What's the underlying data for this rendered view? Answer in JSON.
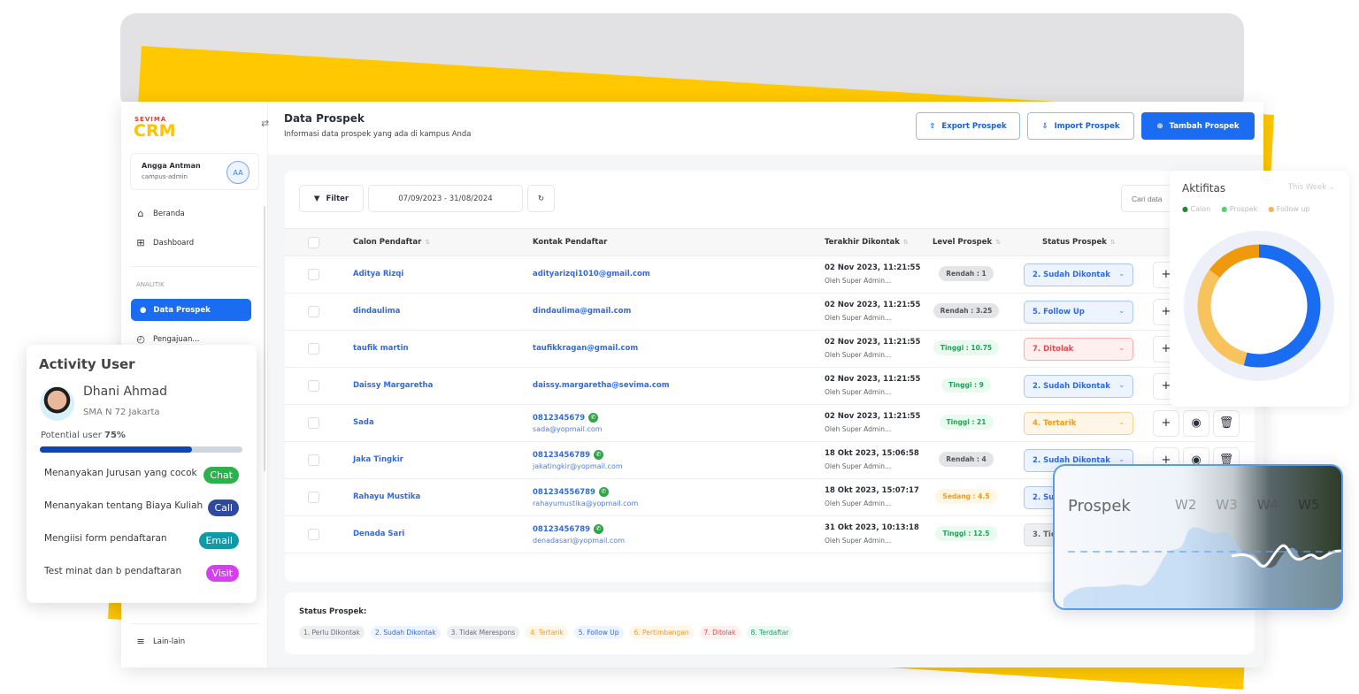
{
  "app": {
    "logo_top": "SEVIMA",
    "logo": "CRM"
  },
  "user": {
    "name": "Angga Antman",
    "role": "campus-admin",
    "initials": "AA"
  },
  "sidebar": {
    "items": [
      {
        "label": "Beranda",
        "icon": "home-icon"
      },
      {
        "label": "Dashboard",
        "icon": "grid-icon"
      }
    ],
    "section": "ANALITIK",
    "active": "Data Prospek",
    "next": "Pengajuan...",
    "bottom": "Lain-lain"
  },
  "header": {
    "title": "Data Prospek",
    "subtitle": "Informasi data prospek yang ada di kampus Anda",
    "export": "Export Prospek",
    "import": "Import Prospek",
    "add": "Tambah Prospek"
  },
  "toolbar": {
    "filter": "Filter",
    "date_range": "07/09/2023 - 31/08/2024",
    "search_placeholder": "Cari data"
  },
  "table": {
    "columns": [
      "Calon Pendaftar",
      "Kontak Pendaftar",
      "Terakhir Dikontak",
      "Level Prospek",
      "Status Prospek"
    ],
    "rows": [
      {
        "name": "Aditya Rizqi",
        "phone": "",
        "email": "adityarizqi1010@gmail.com",
        "date": "02 Nov 2023, 11:21:55",
        "by": "Oleh Super Admin...",
        "level": "Rendah : 1",
        "level_type": "low",
        "status": "2. Sudah Dikontak",
        "status_type": "blue"
      },
      {
        "name": "dindaulima",
        "phone": "",
        "email": "dindaulima@gmail.com",
        "date": "02 Nov 2023, 11:21:55",
        "by": "Oleh Super Admin...",
        "level": "Rendah : 3.25",
        "level_type": "low",
        "status": "5. Follow Up",
        "status_type": "blue"
      },
      {
        "name": "taufik martin",
        "phone": "",
        "email": "taufikkragan@gmail.com",
        "date": "02 Nov 2023, 11:21:55",
        "by": "Oleh Super Admin...",
        "level": "Tinggi : 10.75",
        "level_type": "high",
        "status": "7. Ditolak",
        "status_type": "red"
      },
      {
        "name": "Daissy Margaretha",
        "phone": "",
        "email": "daissy.margaretha@sevima.com",
        "date": "02 Nov 2023, 11:21:55",
        "by": "Oleh Super Admin...",
        "level": "Tinggi : 9",
        "level_type": "high",
        "status": "2. Sudah Dikontak",
        "status_type": "blue"
      },
      {
        "name": "Sada",
        "phone": "0812345679",
        "email": "sada@yopmail.com",
        "date": "02 Nov 2023, 11:21:55",
        "by": "Oleh Super Admin...",
        "level": "Tinggi : 21",
        "level_type": "high",
        "status": "4. Tertarik",
        "status_type": "orange"
      },
      {
        "name": "Jaka Tingkir",
        "phone": "08123456789",
        "email": "jakatingkir@yopmail.com",
        "date": "18 Okt 2023, 15:06:58",
        "by": "Oleh Super Admin...",
        "level": "Rendah : 4",
        "level_type": "low",
        "status": "2. Sudah Dikontak",
        "status_type": "blue"
      },
      {
        "name": "Rahayu Mustika",
        "phone": "081234556789",
        "email": "rahayumustika@yopmail.com",
        "date": "18 Okt 2023, 15:07:17",
        "by": "Oleh Super Admin...",
        "level": "Sedang : 4.5",
        "level_type": "mid",
        "status": "2. Su",
        "status_type": "blue"
      },
      {
        "name": "Denada Sari",
        "phone": "08123456789",
        "email": "denadasari@yopmail.com",
        "date": "31 Okt 2023, 10:13:18",
        "by": "Oleh Super Admin...",
        "level": "Tinggi : 12.5",
        "level_type": "high",
        "status": "3. Tic",
        "status_type": "gray"
      }
    ]
  },
  "legend": {
    "title": "Status Prospek:",
    "items": [
      {
        "label": "1. Perlu Dikontak",
        "color": "#6b6f78",
        "bg": "#eeeff2"
      },
      {
        "label": "2. Sudah Dikontak",
        "color": "#2f6be0",
        "bg": "#eef4ff"
      },
      {
        "label": "3. Tidak Merespons",
        "color": "#6b6f78",
        "bg": "#eeeff2"
      },
      {
        "label": "4. Tertarik",
        "color": "#f29a1a",
        "bg": "#fff6e8"
      },
      {
        "label": "5. Follow Up",
        "color": "#2f6be0",
        "bg": "#eef4ff"
      },
      {
        "label": "6. Pertimbangan",
        "color": "#f29a1a",
        "bg": "#fff6e8"
      },
      {
        "label": "7. Ditolak",
        "color": "#e5484d",
        "bg": "#fff0f0"
      },
      {
        "label": "8. Terdaftar",
        "color": "#1f9e6e",
        "bg": "#eafaf3"
      }
    ]
  },
  "aktifitas": {
    "title": "Aktifitas",
    "period": "This Week",
    "legend": [
      {
        "label": "Calon",
        "color": "#1e8a2e"
      },
      {
        "label": "Prospek",
        "color": "#4cd964"
      },
      {
        "label": "Follow up",
        "color": "#ffb347"
      }
    ],
    "donut": [
      {
        "value": 54,
        "color": "#1a6cf0"
      },
      {
        "value": 31,
        "color": "#f8c25c"
      },
      {
        "value": 15,
        "color": "#ef9a0c"
      }
    ]
  },
  "activity_user": {
    "title": "Activity User",
    "name": "Dhani Ahmad",
    "school": "SMA N 72 Jakarta",
    "potential_label": "Potential user",
    "potential": "75%",
    "potential_value": 0.75,
    "items": [
      {
        "text": "Menanyakan Jurusan yang cocok",
        "tag": "Chat",
        "color": "#2bb24c"
      },
      {
        "text": "Menanyakan tentang Biaya Kuliah",
        "tag": "Call",
        "color": "#2d4aa0"
      },
      {
        "text": "Mengiisi form pendaftaran",
        "tag": "Email",
        "color": "#0e9aa7"
      },
      {
        "text": "Test minat dan b pendaftaran",
        "tag": "Visit",
        "color": "#d63ff0"
      }
    ]
  },
  "prospek_card": {
    "title": "Prospek",
    "weeks": [
      "W2",
      "W3",
      "W4",
      "W5"
    ]
  }
}
